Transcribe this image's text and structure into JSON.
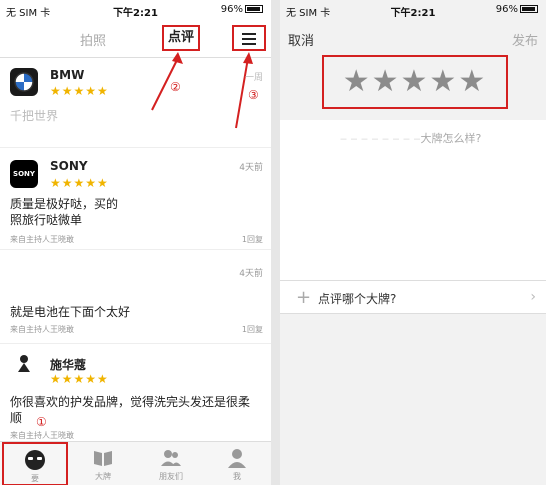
{
  "left": {
    "status": {
      "carrier": "无 SIM 卡",
      "time": "下午2:21",
      "battery": "96%"
    },
    "nav": {
      "tab_photo": "拍照",
      "tab_review": "点评"
    },
    "annotations": {
      "one": "①",
      "two": "②",
      "three": "③"
    },
    "feed": [
      {
        "brand": "BMW",
        "stars": "★★★★★",
        "time": "一周",
        "body": "千把世界"
      },
      {
        "brand": "SONY",
        "stars": "★★★★★",
        "time": "4天前",
        "body_line1": "质量是极好哒，买的",
        "body_line2": "照旅行哒微单",
        "source": "来自主持人王晓敢",
        "reply": "1回复"
      },
      {
        "brand": "",
        "stars": "",
        "time": "4天前",
        "body_line1": "就是电池在下面个太好",
        "source": "来自主持人王晓敢",
        "reply": "1回复"
      },
      {
        "brand": "施华蔻",
        "stars": "★★★★★",
        "time": "",
        "body_line1": "你很喜欢的护发品牌，觉得洗完头发还是很柔",
        "body_line2": "顺",
        "source": "来自主持人王晓敢"
      }
    ],
    "tabs": [
      {
        "label": "要"
      },
      {
        "label": "大牌"
      },
      {
        "label": "朋友们"
      },
      {
        "label": "我"
      }
    ]
  },
  "right": {
    "status": {
      "carrier": "无 SIM 卡",
      "time": "下午2:21",
      "battery": "96%"
    },
    "nav": {
      "cancel": "取消",
      "publish": "发布"
    },
    "stars": "★★★★★",
    "prompt": "大牌怎么样?",
    "pick_brand": "点评哪个大牌?"
  }
}
